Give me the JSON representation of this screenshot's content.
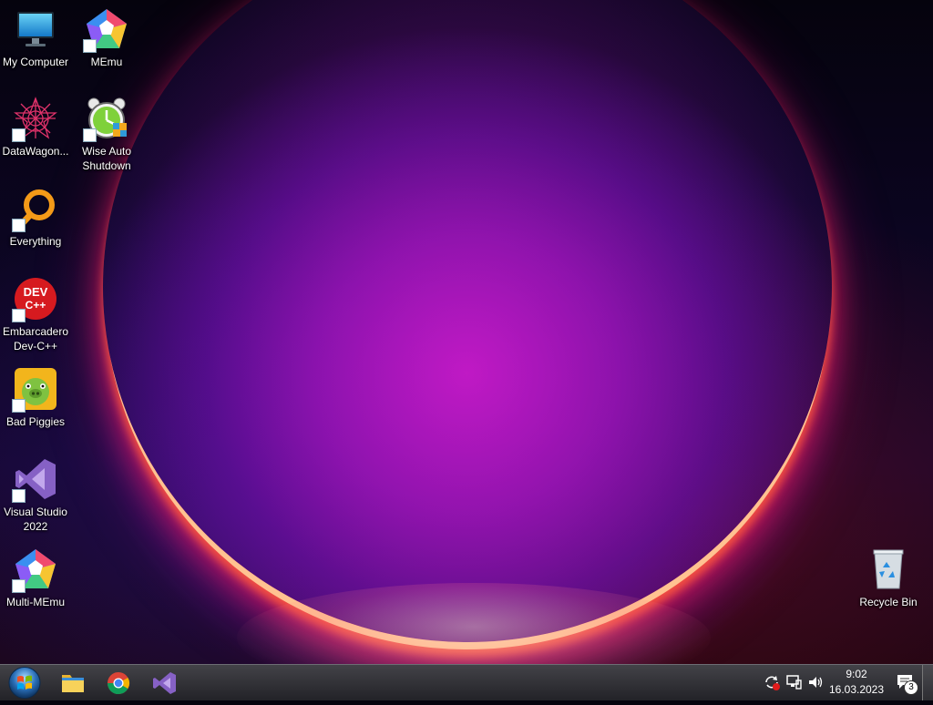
{
  "desktop": {
    "icons": [
      {
        "id": "my-computer",
        "label": "My Computer",
        "icon": "monitor-icon"
      },
      {
        "id": "memu",
        "label": "MEmu",
        "icon": "memu-icon"
      },
      {
        "id": "datawagon",
        "label": "DataWagon...",
        "icon": "datawagon-icon"
      },
      {
        "id": "wise-auto-shutdown",
        "label": "Wise Auto Shutdown",
        "icon": "alarm-clock-icon"
      },
      {
        "id": "everything",
        "label": "Everything",
        "icon": "magnifier-icon"
      },
      {
        "id": "devcpp",
        "label": "Embarcadero Dev-C++",
        "icon": "devcpp-icon",
        "badge": "DEV C++"
      },
      {
        "id": "bad-piggies",
        "label": "Bad Piggies",
        "icon": "pig-icon"
      },
      {
        "id": "visual-studio",
        "label": "Visual Studio 2022",
        "icon": "visual-studio-icon"
      },
      {
        "id": "multi-memu",
        "label": "Multi-MEmu",
        "icon": "memu-icon"
      },
      {
        "id": "recycle-bin",
        "label": "Recycle Bin",
        "icon": "recycle-bin-icon"
      }
    ]
  },
  "taskbar": {
    "start": "start-orb-icon",
    "pinned": [
      {
        "name": "file-explorer-icon"
      },
      {
        "name": "chrome-icon"
      },
      {
        "name": "visual-studio-icon"
      }
    ],
    "tray": {
      "icons": [
        "sync-icon",
        "network-icon",
        "volume-icon"
      ],
      "time": "9:02",
      "date": "16.03.2023",
      "notification_count": "3"
    }
  }
}
